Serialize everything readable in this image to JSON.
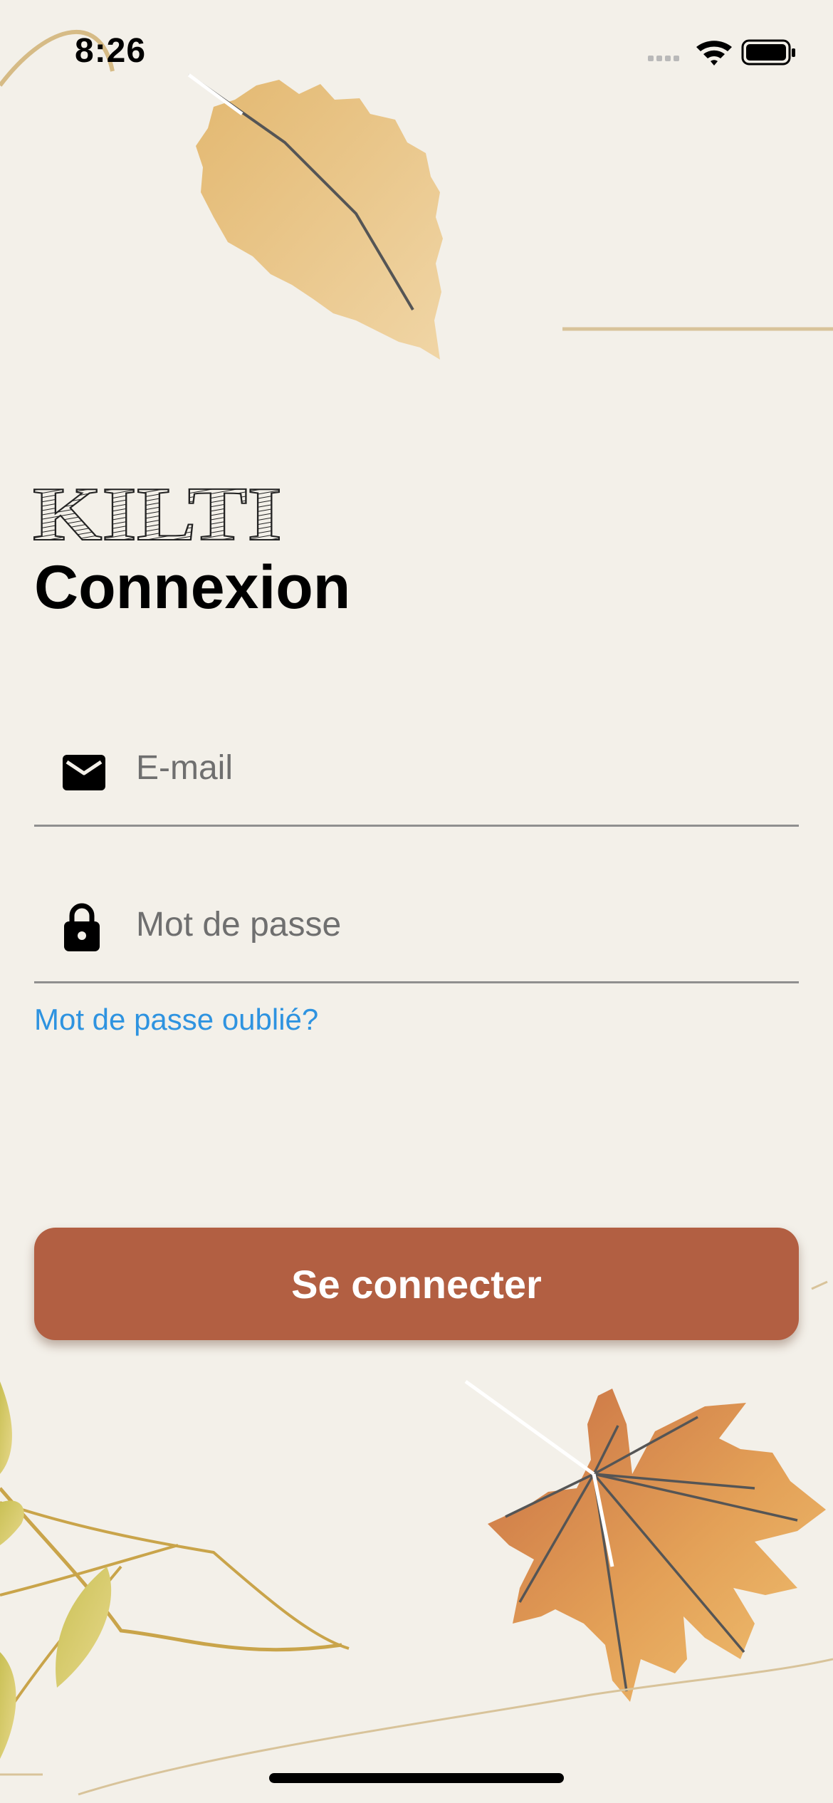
{
  "status_bar": {
    "time": "8:26",
    "icons": [
      "cellular-signal-icon",
      "wifi-icon",
      "battery-icon"
    ]
  },
  "logo": {
    "text": "KILTI"
  },
  "page": {
    "title": "Connexion"
  },
  "form": {
    "email": {
      "placeholder": "E-mail",
      "value": "",
      "icon": "envelope-icon"
    },
    "password": {
      "placeholder": "Mot de passe",
      "value": "",
      "icon": "lock-icon"
    },
    "forgot_password_label": "Mot de passe oublié?",
    "submit_label": "Se connecter"
  },
  "colors": {
    "background": "#f3f0e9",
    "primary_button": "#b25f42",
    "link": "#2e93e0",
    "leaf_gold": "#e6be7a",
    "leaf_orange": "#d98a4e"
  }
}
